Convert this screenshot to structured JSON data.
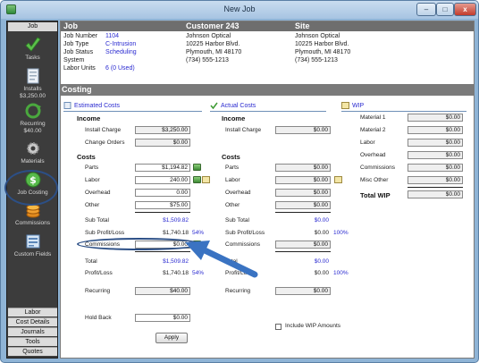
{
  "window": {
    "title": "New Job",
    "minimize": "–",
    "maximize": "□",
    "close": "x"
  },
  "sidebar": {
    "header": "Job",
    "items": [
      {
        "label": "Tasks",
        "sub": "",
        "icon": "checkmark-icon"
      },
      {
        "label": "Installs",
        "sub": "$3,250.00",
        "icon": "document-icon"
      },
      {
        "label": "Recurring",
        "sub": "$40.00",
        "icon": "recurring-icon"
      },
      {
        "label": "Materials",
        "sub": "",
        "icon": "gear-icon"
      },
      {
        "label": "Job Costing",
        "sub": "",
        "icon": "dollar-icon"
      },
      {
        "label": "Commissions",
        "sub": "",
        "icon": "coins-icon"
      },
      {
        "label": "Custom Fields",
        "sub": "",
        "icon": "form-icon"
      }
    ],
    "bottom_tabs": [
      "Labor",
      "Cost Details",
      "Journals",
      "Tools",
      "Quotes"
    ]
  },
  "header": {
    "job_title": "Job",
    "customer_title": "Customer 243",
    "site_title": "Site",
    "job_fields": [
      {
        "label": "Job Number",
        "value": "1104"
      },
      {
        "label": "Job Type",
        "value": "C-Intrusion"
      },
      {
        "label": "Job Status",
        "value": "Scheduling"
      },
      {
        "label": "System",
        "value": ""
      },
      {
        "label": "Labor Units",
        "value": "6 (0 Used)"
      }
    ],
    "customer_lines": [
      "Johnson Optical",
      "10225 Harbor Blvd.",
      "Plymouth, MI  48170",
      "(734) 555-1213"
    ],
    "site_lines": [
      "Johnson Optical",
      "10225 Harbor Blvd.",
      "Plymouth, MI  48170",
      "(734) 555-1213"
    ]
  },
  "costing": {
    "section_title": "Costing",
    "estimated": {
      "heading": "Estimated Costs",
      "income_label": "Income",
      "install_charge_label": "Install Charge",
      "install_charge": "$3,250.00",
      "change_orders_label": "Change Orders",
      "change_orders": "$0.00",
      "costs_label": "Costs",
      "parts_label": "Parts",
      "parts": "$1,194.82",
      "labor_label": "Labor",
      "labor": "240.00",
      "overhead_label": "Overhead",
      "overhead": "0.00",
      "other_label": "Other",
      "other": "$75.00",
      "subtotal_label": "Sub Total",
      "subtotal": "$1,509.82",
      "sub_profit_label": "Sub Profit/Loss",
      "sub_profit": "$1,740.18",
      "sub_profit_pct": "54%",
      "commissions_label": "Commissions",
      "commissions": "$0.00",
      "total_label": "Total",
      "total": "$1,509.82",
      "profit_label": "Profit/Loss",
      "profit": "$1,740.18",
      "profit_pct": "54%",
      "recurring_label": "Recurring",
      "recurring": "$40.00",
      "holdback_label": "Hold Back",
      "holdback": "$0.00"
    },
    "actual": {
      "heading": "Actual Costs",
      "income_label": "Income",
      "install_charge_label": "Install Charge",
      "install_charge": "$0.00",
      "costs_label": "Costs",
      "parts_label": "Parts",
      "parts": "$0.00",
      "labor_label": "Labor",
      "labor": "$0.00",
      "overhead_label": "Overhead",
      "overhead": "$0.00",
      "other_label": "Other",
      "other": "$0.00",
      "subtotal_label": "Sub Total",
      "subtotal": "$0.00",
      "sub_profit_label": "Sub Profit/Loss",
      "sub_profit": "$0.00",
      "sub_profit_pct": "100%",
      "commissions_label": "Commissions",
      "commissions": "$0.00",
      "total_label": "Total",
      "total": "$0.00",
      "profit_label": "Profit/Loss",
      "profit": "$0.00",
      "profit_pct": "100%",
      "recurring_label": "Recurring",
      "recurring": "$0.00"
    },
    "wip": {
      "heading": "WIP",
      "material1_label": "Material 1",
      "material1": "$0.00",
      "material2_label": "Material 2",
      "material2": "$0.00",
      "labor_label": "Labor",
      "labor": "$0.00",
      "overhead_label": "Overhead",
      "overhead": "$0.00",
      "commissions_label": "Commissions",
      "commissions": "$0.00",
      "misc_label": "Misc Other",
      "misc": "$0.00",
      "total_label": "Total WIP",
      "total": "$0.00"
    },
    "include_wip_label": "Include WIP Amounts",
    "apply_label": "Apply"
  },
  "colors": {
    "accent": "#2a2ad0",
    "highlight": "#2c4f86",
    "arrow": "#3a73c2"
  }
}
